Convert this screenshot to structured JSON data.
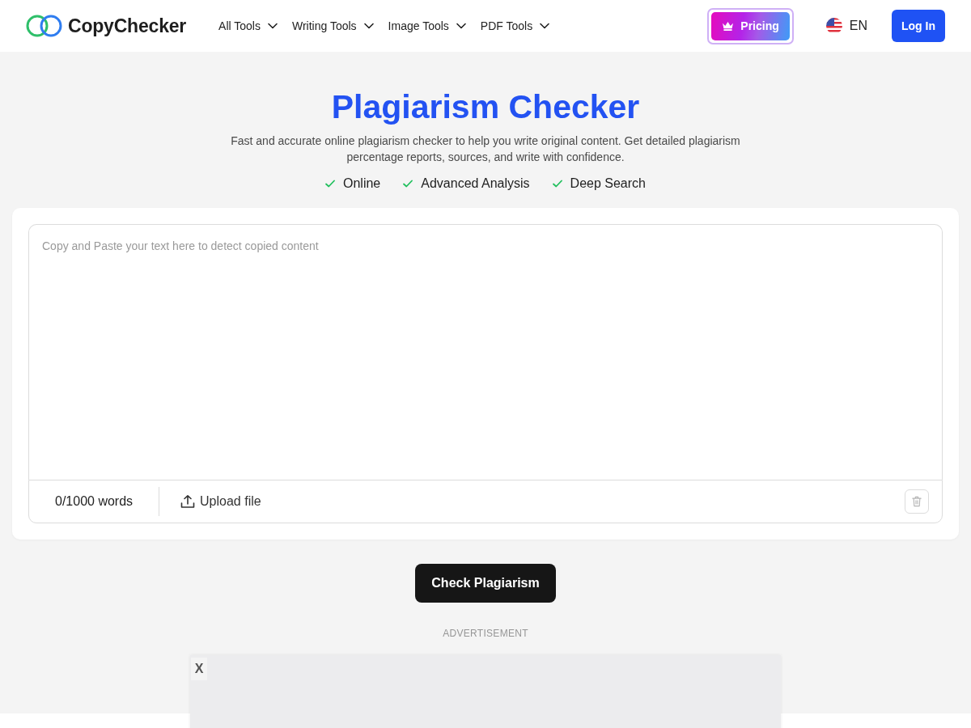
{
  "header": {
    "logo": "CopyChecker",
    "nav": [
      {
        "label": "All Tools"
      },
      {
        "label": "Writing Tools"
      },
      {
        "label": "Image Tools"
      },
      {
        "label": "PDF Tools"
      }
    ],
    "pricing": "Pricing",
    "language": "EN",
    "login": "Log In"
  },
  "hero": {
    "title": "Plagiarism Checker",
    "description": "Fast and accurate online plagiarism checker to help you write original content. Get detailed plagiarism percentage reports, sources, and write with confidence.",
    "features": [
      "Online",
      "Advanced Analysis",
      "Deep Search"
    ]
  },
  "editor": {
    "placeholder": "Copy and Paste your text here to detect copied content",
    "word_count": "0/1000 words",
    "upload": "Upload file"
  },
  "check_button": "Check Plagiarism",
  "ad": {
    "label": "ADVERTISEMENT",
    "close": "X"
  }
}
